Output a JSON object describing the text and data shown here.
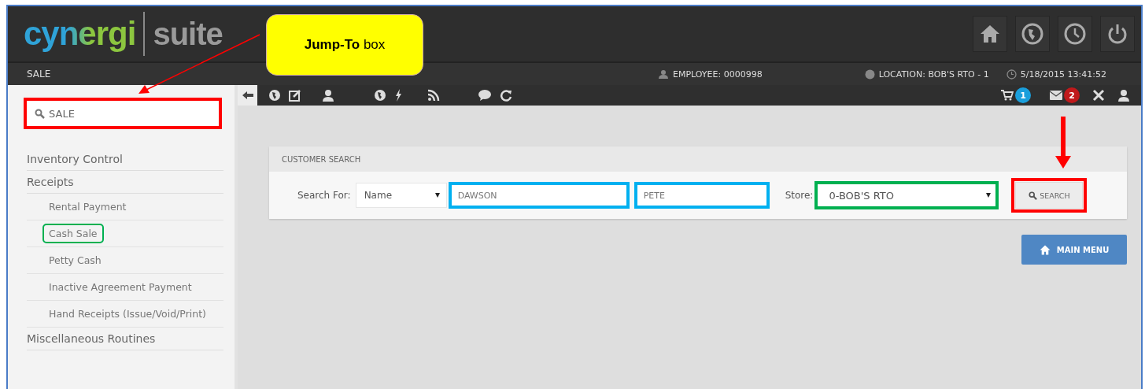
{
  "logo": {
    "left": "cynergi",
    "right": "suite"
  },
  "status_bar": {
    "page_title": "SALE",
    "employee": "EMPLOYEE: 0000998",
    "location": "LOCATION: BOB'S RTO - 1",
    "datetime": "5/18/2015 13:41:52"
  },
  "toolbar": {
    "cart_count": "1",
    "mail_count": "2"
  },
  "jump_to": {
    "value": "SALE",
    "color": "#ff0000"
  },
  "sidebar": {
    "items": [
      {
        "label": "Inventory Control"
      },
      {
        "label": "Receipts",
        "children": [
          {
            "label": "Rental Payment"
          },
          {
            "label": "Cash Sale",
            "color": "#00b050"
          },
          {
            "label": "Petty Cash"
          },
          {
            "label": "Inactive Agreement Payment"
          },
          {
            "label": "Hand Receipts (Issue/Void/Print)"
          }
        ]
      },
      {
        "label": "Miscellaneous Routines"
      }
    ]
  },
  "customer_search": {
    "title": "CUSTOMER SEARCH",
    "search_for_label": "Search For:",
    "search_for_value": "Name",
    "last_name": {
      "value": "DAWSON",
      "color": "#00b0f0"
    },
    "first_name": {
      "value": "PETE",
      "color": "#00b0f0"
    },
    "store_label": "Store:",
    "store": {
      "value": "0-BOB'S RTO",
      "color": "#00b050"
    },
    "search_button": {
      "label": "SEARCH",
      "color": "#ff0000"
    }
  },
  "main_menu_button": "MAIN MENU",
  "callout": {
    "text": "**Jump-To** box"
  }
}
